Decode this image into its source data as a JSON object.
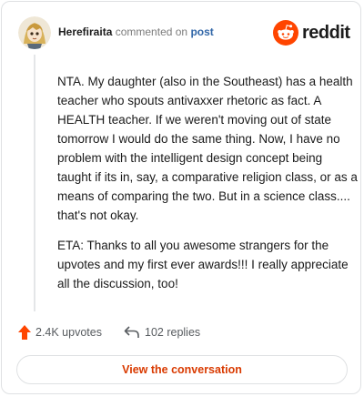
{
  "header": {
    "username": "Herefiraita",
    "action_text": "commented on",
    "post_link": "post",
    "brand_word": "reddit",
    "brand_color": "#ff4500"
  },
  "comment": {
    "paragraphs": [
      "NTA. My daughter (also in the Southeast) has a health teacher who spouts antivaxxer rhetoric as fact. A HEALTH teacher. If we weren't moving out of state tomorrow I would do the same thing. Now, I have no problem with the intelligent design concept being taught if its in, say, a comparative religion class, or as a means of comparing the two. But in a science class.... that's not okay.",
      "ETA: Thanks to all you awesome strangers for the upvotes and my first ever awards!!! I really appreciate all the discussion, too!"
    ]
  },
  "actions": {
    "upvotes": "2.4K upvotes",
    "replies": "102 replies",
    "upvote_icon": "upvote-arrow-icon",
    "reply_icon": "reply-arrow-icon"
  },
  "footer": {
    "button_label": "View the conversation",
    "accent_color": "#d93a00"
  }
}
